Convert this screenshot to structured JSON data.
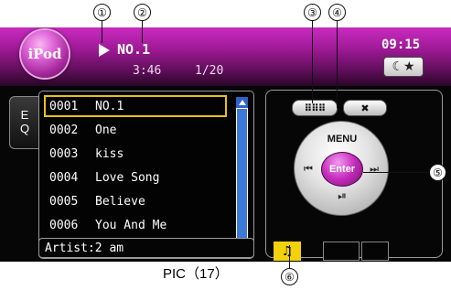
{
  "header": {
    "logo_text": "iPod",
    "track_title": "NO.1",
    "elapsed": "3:46",
    "track_position": "1/20",
    "clock": "09:15",
    "night_mode_icon": "moon-star-icon"
  },
  "eq_tab": {
    "label_line1": "E",
    "label_line2": "Q"
  },
  "playlist": {
    "rows": [
      {
        "num": "0001",
        "title": "NO.1"
      },
      {
        "num": "0002",
        "title": "One"
      },
      {
        "num": "0003",
        "title": "kiss"
      },
      {
        "num": "0004",
        "title": "Love Song"
      },
      {
        "num": "0005",
        "title": "Believe"
      },
      {
        "num": "0006",
        "title": "You And Me"
      }
    ],
    "selected_index": 0
  },
  "artist": "Artist:2 am",
  "controls": {
    "keypad_icon": "keypad-icon",
    "keypad_glyph": "⠿⠿⠿",
    "settings_icon": "tools-icon",
    "settings_glyph": "✖",
    "menu_label": "MENU",
    "enter_label": "Enter",
    "prev_glyph": "⏮",
    "next_glyph": "⏭",
    "playpause_glyph": "⏯",
    "music_source_glyph": "♫"
  },
  "callouts": [
    "①",
    "②",
    "③",
    "④",
    "⑤",
    "⑥"
  ],
  "caption": "PIC（17）",
  "colors": {
    "header_purple": "#a11a98",
    "enter_magenta": "#c42bbb",
    "selection_yellow": "#e7c21a",
    "scrollbar_blue": "#3c78d8",
    "music_button_yellow": "#f2d20a"
  }
}
